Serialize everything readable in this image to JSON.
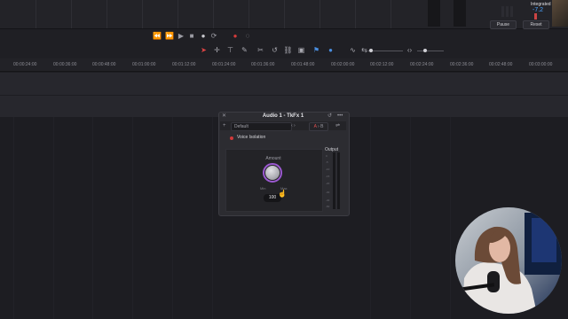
{
  "loudness": {
    "integrated_label": "Integrated",
    "integrated_value": "-7.2",
    "pause_label": "Pause",
    "reset_label": "Reset"
  },
  "transport": {
    "rewind": "⏪",
    "forward": "⏩",
    "play": "▶",
    "stop": "■",
    "record": "●",
    "loop": "⟳"
  },
  "ruler": {
    "timecodes": [
      "00:00:24:00",
      "00:00:36:00",
      "00:00:48:00",
      "00:01:00:00",
      "00:01:12:00",
      "00:01:24:00",
      "00:01:36:00",
      "00:01:48:00",
      "00:02:00:00",
      "00:02:12:00",
      "00:02:24:00",
      "00:02:36:00",
      "00:02:48:00",
      "00:03:00:00"
    ]
  },
  "plugin": {
    "title": "Audio 1 - TkFx 1",
    "close_icon": "✕",
    "preset_add": "+",
    "preset_name": "Default",
    "preset_nav": "‹ ›",
    "ab_a": "A",
    "ab_sep": " › ",
    "ab_b": "B",
    "effect_name": "Voice Isolation",
    "amount_label": "Amount",
    "min_label": "Min",
    "max_label": "Max",
    "amount_value": "100",
    "output_label": "Output",
    "output_scale": [
      "0",
      "-5",
      "-10",
      "-15",
      "-20",
      "-30",
      "-40",
      "-50"
    ]
  },
  "colors": {
    "accent_purple": "#9b59d0",
    "record_red": "#d33a3a",
    "loudness_blue": "#4aa3ff"
  }
}
